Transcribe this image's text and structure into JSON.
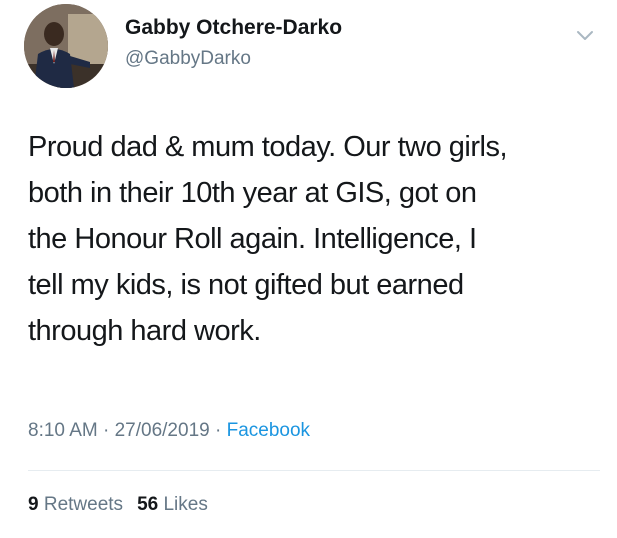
{
  "user": {
    "name": "Gabby Otchere-Darko",
    "handle": "@GabbyDarko"
  },
  "tweet": {
    "lines": [
      "Proud dad & mum today. Our two girls,",
      "both in their 10th year at GIS, got on",
      "the Honour Roll again. Intelligence, I",
      "tell my kids, is not gifted but earned",
      "through hard work."
    ]
  },
  "meta": {
    "time": "8:10 AM",
    "date": "27/06/2019",
    "separator": " · ",
    "source": "Facebook"
  },
  "stats": {
    "retweets_count": "9",
    "retweets_label": "Retweets",
    "likes_count": "56",
    "likes_label": "Likes"
  },
  "colors": {
    "text": "#14171a",
    "secondary": "#657786",
    "link": "#1b95e0",
    "divider": "#e6ecf0"
  },
  "icons": {
    "chevron": "chevron-down-icon"
  }
}
